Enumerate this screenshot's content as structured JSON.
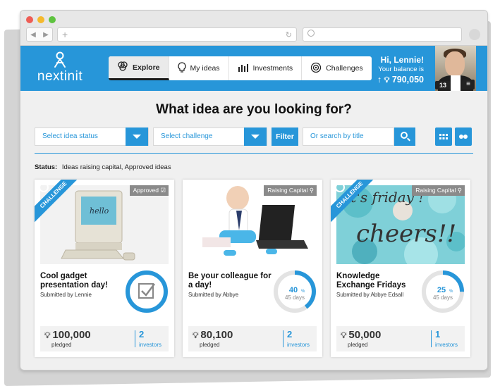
{
  "browser": {
    "dot_colors": [
      "#ee5d55",
      "#f5b92d",
      "#5ec33f"
    ],
    "back_icon": "back-arrow-icon",
    "forward_icon": "forward-arrow-icon",
    "new_tab_icon": "plus-icon",
    "reload_icon": "reload-icon"
  },
  "header": {
    "brand": "nextinit",
    "tabs": [
      {
        "label": "Explore",
        "icon": "circles-icon",
        "active": true
      },
      {
        "label": "My ideas",
        "icon": "lightbulb-icon",
        "active": false
      },
      {
        "label": "Investments",
        "icon": "bar-chart-icon",
        "active": false
      },
      {
        "label": "Challenges",
        "icon": "target-icon",
        "active": false
      }
    ],
    "greeting": "Hi, Lennie!",
    "balance_label": "Your balance is",
    "balance": "790,050",
    "notification_count": "13",
    "accent_color": "#2796d9"
  },
  "main": {
    "headline": "What idea are you looking for?",
    "filters": {
      "status_placeholder": "Select idea status",
      "challenge_placeholder": "Select challenge",
      "filter_button": "Filter",
      "search_placeholder": "Or search by title"
    },
    "status_label": "Status:",
    "status_value": "Ideas raising capital, Approved ideas"
  },
  "cards": [
    {
      "ribbon": "CHALLENGE",
      "tag": "Approved",
      "title": "Cool gadget presentation day!",
      "submitted_by": "Submitted by Lennie",
      "approved": true,
      "pledged": "100,000",
      "pledged_label": "pledged",
      "investors": "2",
      "investors_label": "investors"
    },
    {
      "tag": "Raising Capital",
      "title": "Be your colleague for a day!",
      "submitted_by": "Submitted by Abbye",
      "percent": "40",
      "progress": 0.4,
      "days": "45 days",
      "pledged": "80,100",
      "pledged_label": "pledged",
      "investors": "2",
      "investors_label": "investors"
    },
    {
      "ribbon": "CHALLENGE",
      "tag": "Raising Capital",
      "image_text_1": "it's friday !",
      "image_text_2": "cheers!!",
      "title": "Knowledge Exchange Fridays",
      "submitted_by": "Submitted by Abbye Edsall",
      "percent": "25",
      "progress": 0.25,
      "days": "45 days",
      "pledged": "50,000",
      "pledged_label": "pledged",
      "investors": "1",
      "investors_label": "investors"
    }
  ]
}
